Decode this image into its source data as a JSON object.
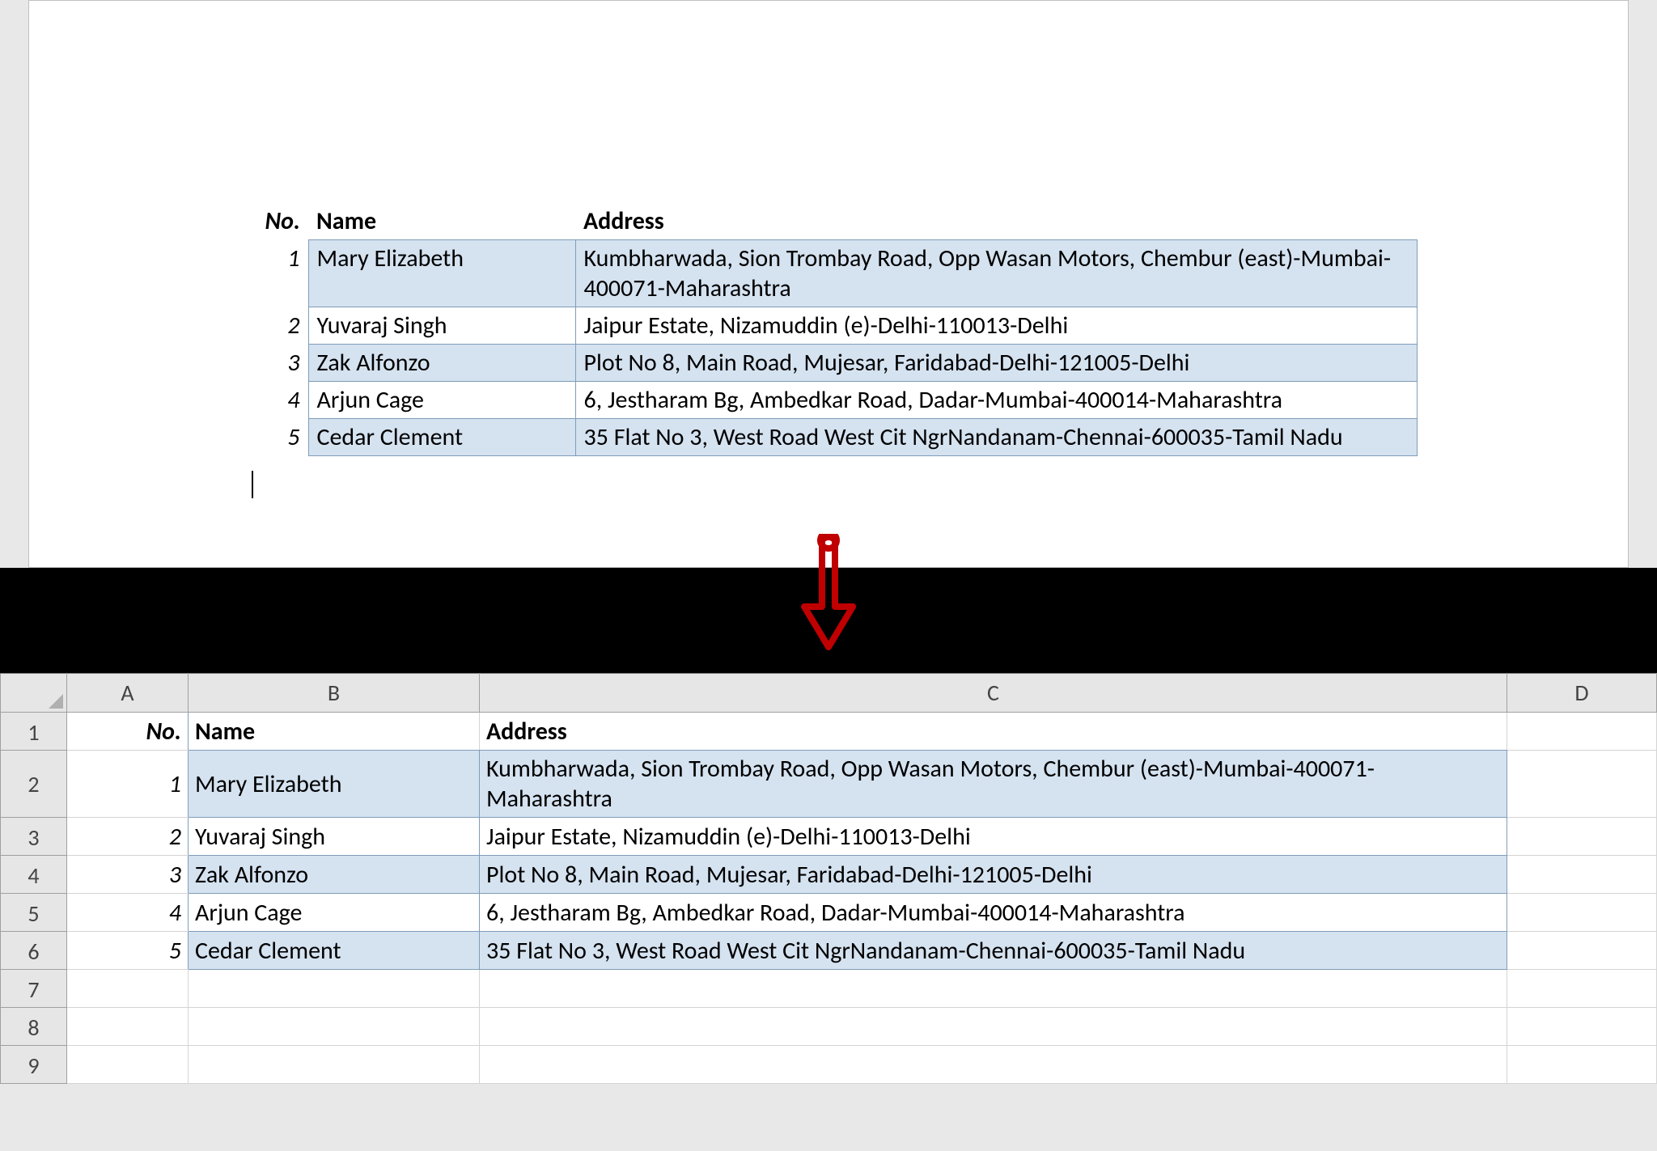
{
  "headers": {
    "no": "No.",
    "name": "Name",
    "address": "Address"
  },
  "rows": [
    {
      "no": "1",
      "name": "Mary Elizabeth",
      "address": "Kumbharwada, Sion Trombay Road, Opp Wasan Motors, Chembur (east)-Mumbai-400071-Maharashtra"
    },
    {
      "no": "2",
      "name": "Yuvaraj Singh",
      "address": "Jaipur Estate, Nizamuddin (e)-Delhi-110013-Delhi"
    },
    {
      "no": "3",
      "name": "Zak Alfonzo",
      "address": "Plot No 8, Main Road, Mujesar, Faridabad-Delhi-121005-Delhi"
    },
    {
      "no": "4",
      "name": "Arjun Cage",
      "address": "6, Jestharam Bg, Ambedkar Road, Dadar-Mumbai-400014-Maharashtra"
    },
    {
      "no": "5",
      "name": "Cedar Clement",
      "address": "35 Flat No 3, West Road West Cit NgrNandanam-Chennai-600035-Tamil Nadu"
    }
  ],
  "excel_columns": {
    "A": "A",
    "B": "B",
    "C": "C",
    "D": "D"
  },
  "excel_row_labels": [
    "1",
    "2",
    "3",
    "4",
    "5",
    "6",
    "7",
    "8",
    "9"
  ]
}
